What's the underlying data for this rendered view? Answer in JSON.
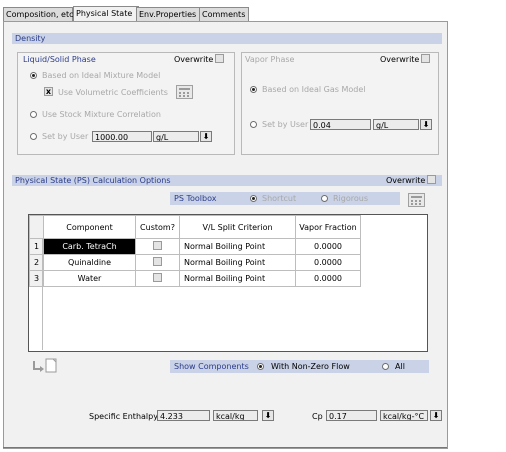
{
  "tabs": [
    {
      "label": "Composition, etc."
    },
    {
      "label": "Physical State"
    },
    {
      "label": "Env.Properties"
    },
    {
      "label": "Comments"
    }
  ],
  "density": {
    "title": "Density",
    "liquid": {
      "title": "Liquid/Solid Phase",
      "overwrite_label": "Overwrite",
      "opt_ideal": "Based on Ideal Mixture Model",
      "opt_volumetric": "Use Volumetric Coefficients",
      "opt_stock": "Use Stock Mixture Correlation",
      "opt_user": "Set by User",
      "user_value": "1000.00",
      "user_unit": "g/L"
    },
    "vapor": {
      "title": "Vapor Phase",
      "overwrite_label": "Overwrite",
      "opt_ideal_gas": "Based on Ideal Gas Model",
      "opt_user": "Set by User",
      "user_value": "0.04",
      "user_unit": "g/L"
    }
  },
  "ps": {
    "title": "Physical State (PS) Calculation Options",
    "overwrite_label": "Overwrite",
    "toolbox_label": "PS Toolbox",
    "opt_shortcut": "Shortcut",
    "opt_rigorous": "Rigorous",
    "columns": [
      "Component",
      "Custom?",
      "V/L Split Criterion",
      "Vapor Fraction"
    ],
    "rows": [
      {
        "num": "1",
        "component": "Carb. TetraCh",
        "criterion": "Normal Boiling Point",
        "vapor_fraction": "0.0000"
      },
      {
        "num": "2",
        "component": "Quinaldine",
        "criterion": "Normal Boiling Point",
        "vapor_fraction": "0.0000"
      },
      {
        "num": "3",
        "component": "Water",
        "criterion": "Normal Boiling Point",
        "vapor_fraction": "0.0000"
      }
    ],
    "show_components_label": "Show Components",
    "opt_nonzero": "With Non-Zero Flow",
    "opt_all": "All"
  },
  "footer": {
    "enthalpy_label": "Specific Enthalpy",
    "enthalpy_value": "4.233",
    "enthalpy_unit": "kcal/kg",
    "cp_label": "Cp",
    "cp_value": "0.17",
    "cp_unit": "kcal/kg-°C"
  },
  "colors": {
    "section_header_bg": "#c9d2e6",
    "section_header_text": "#2b3c8a"
  },
  "icons": [
    "calculator-icon",
    "dropdown-arrow-icon",
    "export-arrow-icon"
  ]
}
